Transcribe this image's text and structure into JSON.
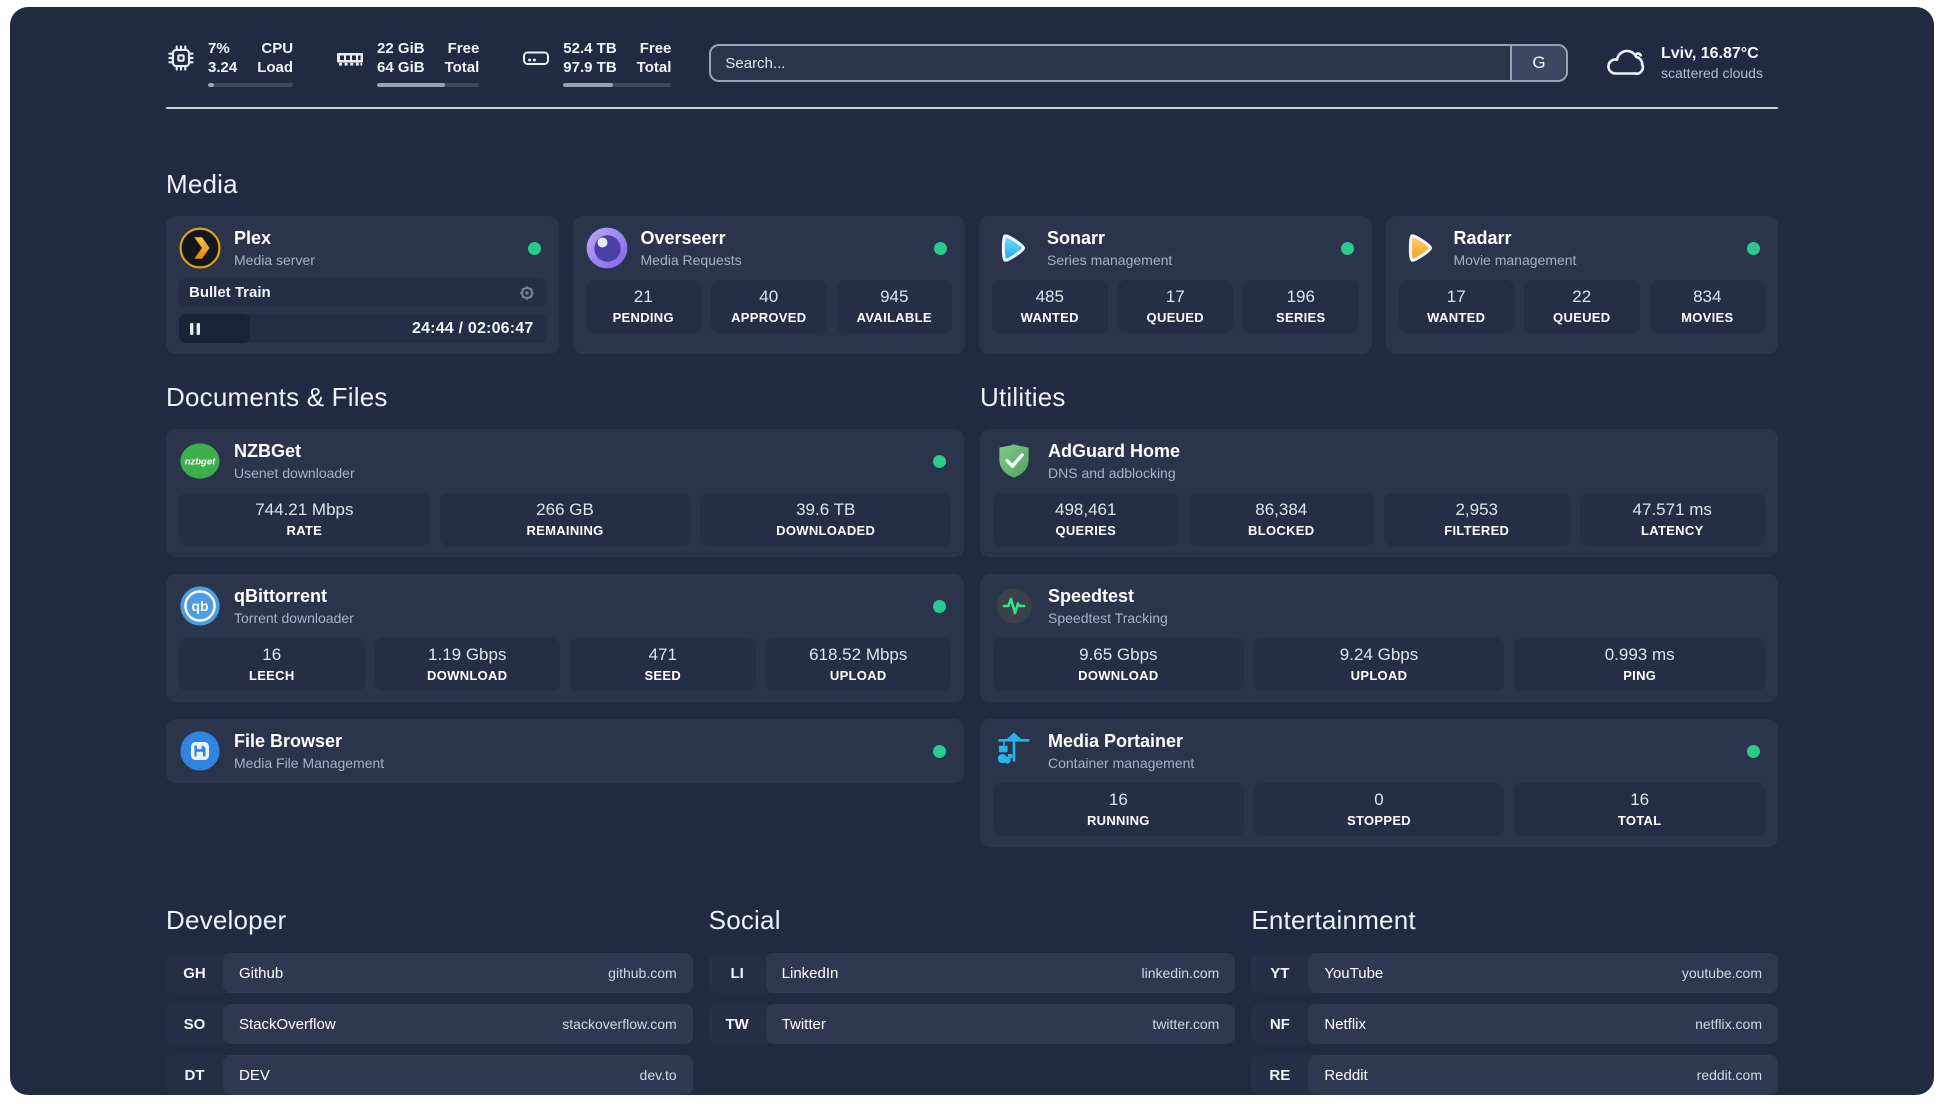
{
  "header": {
    "stats": [
      {
        "id": "cpu",
        "value1": "7%",
        "value2": "3.24",
        "label1": "CPU",
        "label2": "Load",
        "progress": 7
      },
      {
        "id": "memory",
        "value1": "22 GiB",
        "value2": "64 GiB",
        "label1": "Free",
        "label2": "Total",
        "progress": 66
      },
      {
        "id": "storage",
        "value1": "52.4 TB",
        "value2": "97.9 TB",
        "label1": "Free",
        "label2": "Total",
        "progress": 46
      }
    ],
    "search": {
      "placeholder": "Search...",
      "engine_button_label": "G"
    },
    "weather": {
      "location": "Lviv, 16.87°C",
      "condition": "scattered clouds"
    }
  },
  "media": {
    "title": "Media",
    "plex": {
      "name": "Plex",
      "description": "Media server",
      "status": "online",
      "now_playing": "Bullet Train",
      "time": "24:44 / 02:06:47",
      "progress_percent": 19.5
    },
    "overseerr": {
      "name": "Overseerr",
      "description": "Media Requests",
      "status": "online",
      "stats": [
        {
          "value": "21",
          "label": "PENDING"
        },
        {
          "value": "40",
          "label": "APPROVED"
        },
        {
          "value": "945",
          "label": "AVAILABLE"
        }
      ]
    },
    "sonarr": {
      "name": "Sonarr",
      "description": "Series management",
      "status": "online",
      "stats": [
        {
          "value": "485",
          "label": "WANTED"
        },
        {
          "value": "17",
          "label": "QUEUED"
        },
        {
          "value": "196",
          "label": "SERIES"
        }
      ]
    },
    "radarr": {
      "name": "Radarr",
      "description": "Movie management",
      "status": "online",
      "stats": [
        {
          "value": "17",
          "label": "WANTED"
        },
        {
          "value": "22",
          "label": "QUEUED"
        },
        {
          "value": "834",
          "label": "MOVIES"
        }
      ]
    }
  },
  "documents": {
    "title": "Documents & Files",
    "nzbget": {
      "name": "NZBGet",
      "description": "Usenet downloader",
      "status": "online",
      "stats": [
        {
          "value": "744.21 Mbps",
          "label": "RATE"
        },
        {
          "value": "266 GB",
          "label": "REMAINING"
        },
        {
          "value": "39.6 TB",
          "label": "DOWNLOADED"
        }
      ]
    },
    "qbittorrent": {
      "name": "qBittorrent",
      "description": "Torrent downloader",
      "status": "online",
      "stats": [
        {
          "value": "16",
          "label": "LEECH"
        },
        {
          "value": "1.19 Gbps",
          "label": "DOWNLOAD"
        },
        {
          "value": "471",
          "label": "SEED"
        },
        {
          "value": "618.52 Mbps",
          "label": "UPLOAD"
        }
      ]
    },
    "filebrowser": {
      "name": "File Browser",
      "description": "Media File Management",
      "status": "online"
    }
  },
  "utilities": {
    "title": "Utilities",
    "adguard": {
      "name": "AdGuard Home",
      "description": "DNS and adblocking",
      "stats": [
        {
          "value": "498,461",
          "label": "QUERIES"
        },
        {
          "value": "86,384",
          "label": "BLOCKED"
        },
        {
          "value": "2,953",
          "label": "FILTERED"
        },
        {
          "value": "47.571 ms",
          "label": "LATENCY"
        }
      ]
    },
    "speedtest": {
      "name": "Speedtest",
      "description": "Speedtest Tracking",
      "stats": [
        {
          "value": "9.65 Gbps",
          "label": "DOWNLOAD"
        },
        {
          "value": "9.24 Gbps",
          "label": "UPLOAD"
        },
        {
          "value": "0.993 ms",
          "label": "PING"
        }
      ]
    },
    "portainer": {
      "name": "Media Portainer",
      "description": "Container management",
      "status": "online",
      "stats": [
        {
          "value": "16",
          "label": "RUNNING"
        },
        {
          "value": "0",
          "label": "STOPPED"
        },
        {
          "value": "16",
          "label": "TOTAL"
        }
      ]
    }
  },
  "developer": {
    "title": "Developer",
    "links": [
      {
        "tag": "GH",
        "name": "Github",
        "url": "github.com"
      },
      {
        "tag": "SO",
        "name": "StackOverflow",
        "url": "stackoverflow.com"
      },
      {
        "tag": "DT",
        "name": "DEV",
        "url": "dev.to"
      }
    ]
  },
  "social": {
    "title": "Social",
    "links": [
      {
        "tag": "LI",
        "name": "LinkedIn",
        "url": "linkedin.com"
      },
      {
        "tag": "TW",
        "name": "Twitter",
        "url": "twitter.com"
      }
    ]
  },
  "entertainment": {
    "title": "Entertainment",
    "links": [
      {
        "tag": "YT",
        "name": "YouTube",
        "url": "youtube.com"
      },
      {
        "tag": "NF",
        "name": "Netflix",
        "url": "netflix.com"
      },
      {
        "tag": "RE",
        "name": "Reddit",
        "url": "reddit.com"
      }
    ]
  },
  "colors": {
    "page_background": "#202a41",
    "card_background": "#2a344b",
    "inset_background": "#242e44",
    "status_online": "#2bc98c",
    "plex_orange": "#e5a00d",
    "sonarr_cyan": "#35c5f4",
    "radarr_gold": "#f0a21a",
    "nzbget_green": "#3db04b",
    "qbittorrent_blue": "#4d9de0",
    "filebrowser_blue": "#2e86e0",
    "adguard_green": "#68bc71",
    "speedtest_green": "#35e08d",
    "portainer_blue": "#29b3e6"
  }
}
